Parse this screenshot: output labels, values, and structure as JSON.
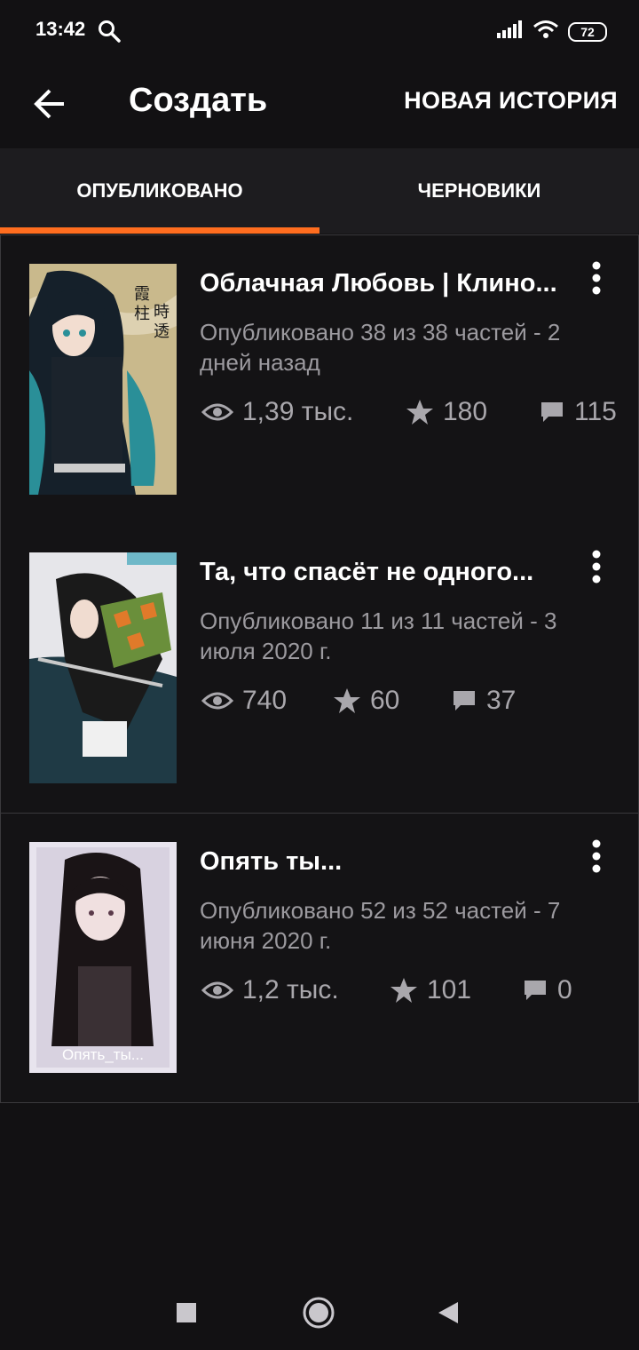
{
  "status": {
    "time": "13:42",
    "battery": "72"
  },
  "appbar": {
    "title": "Создать",
    "new_story": "НОВАЯ ИСТОРИЯ"
  },
  "tabs": {
    "published": "ОПУБЛИКОВАНО",
    "drafts": "ЧЕРНОВИКИ"
  },
  "stories": [
    {
      "title": "Облачная Любовь | Клино...",
      "meta": "Опубликовано 38 из 38 частей - 2 дней назад",
      "views": "1,39 тыс.",
      "votes": "180",
      "comments": "115"
    },
    {
      "title": "Та, что спасёт не одного...",
      "meta": "Опубликовано 11 из 11 частей - 3 июля 2020 г.",
      "views": "740",
      "votes": "60",
      "comments": "37"
    },
    {
      "title": "Опять ты...",
      "meta": "Опубликовано 52 из 52 частей - 7 июня 2020 г.",
      "views": "1,2 тыс.",
      "votes": "101",
      "comments": "0",
      "cover_text": "Опять_ты..."
    }
  ],
  "colors": {
    "accent": "#ff6d1f",
    "background": "#121113",
    "tabs_background": "#1d1c1f"
  }
}
